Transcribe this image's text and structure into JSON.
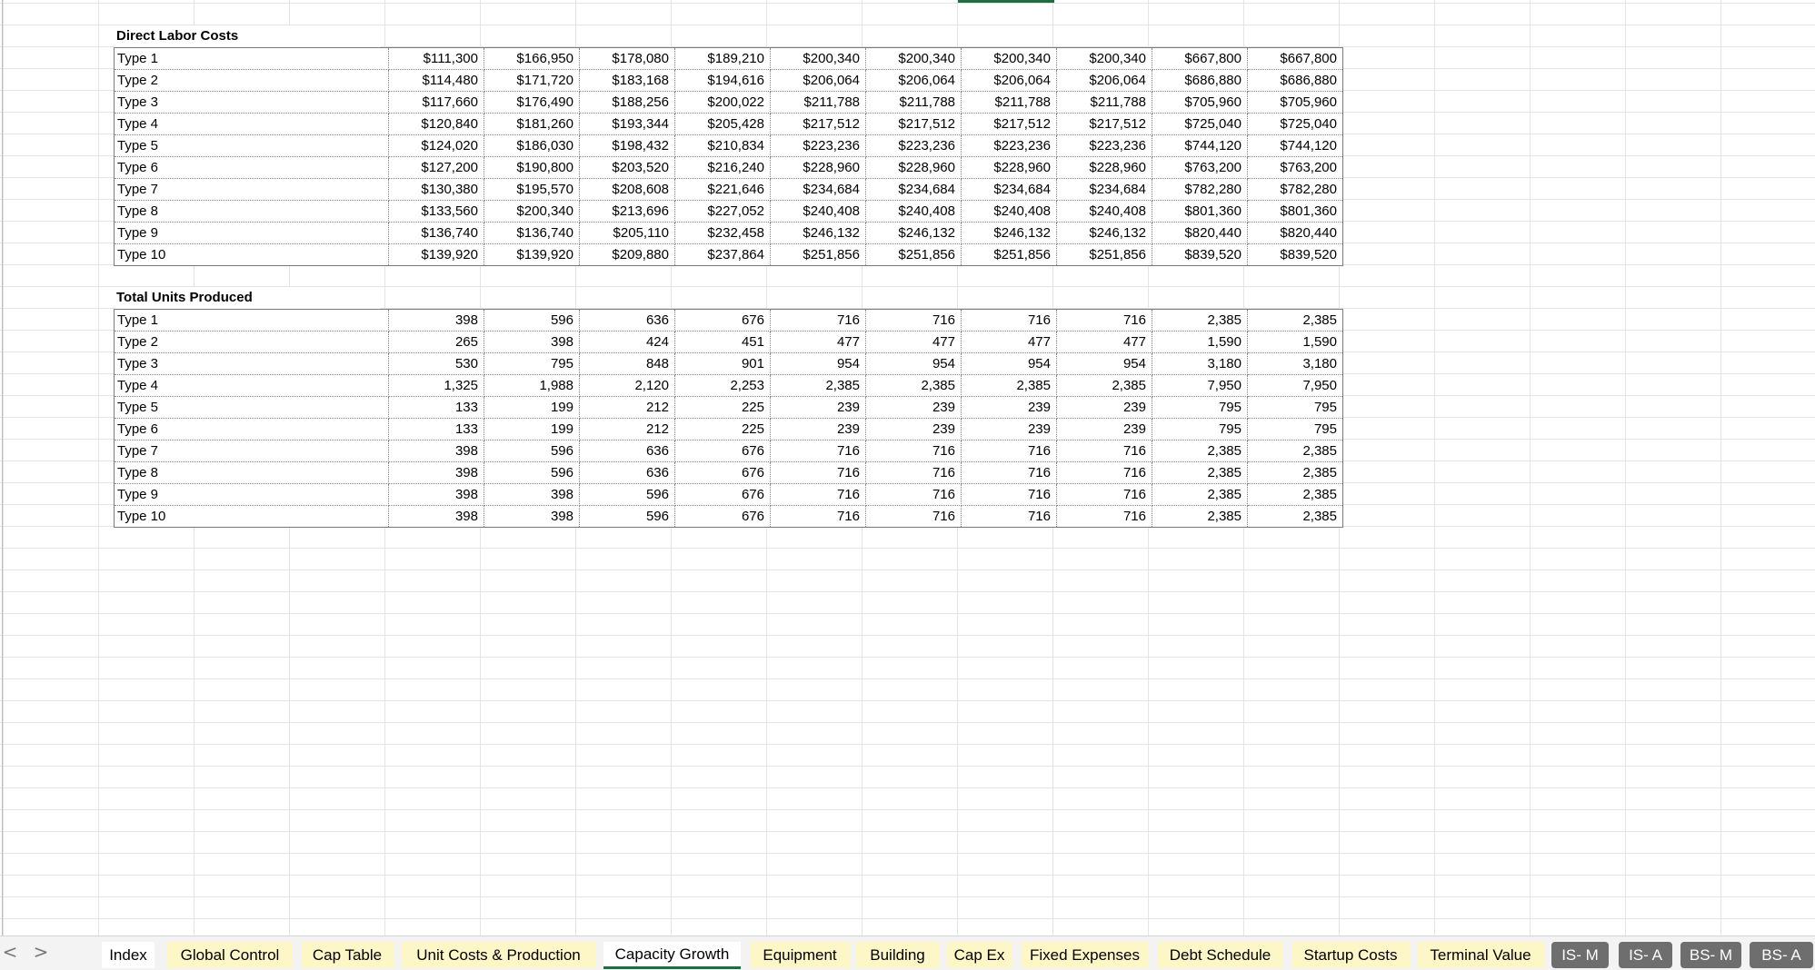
{
  "sections": {
    "labor": {
      "title": "Direct Labor Costs",
      "rows": [
        {
          "label": "Type 1",
          "values": [
            "$111,300",
            "$166,950",
            "$178,080",
            "$189,210",
            "$200,340",
            "$200,340",
            "$200,340",
            "$200,340",
            "$667,800",
            "$667,800"
          ]
        },
        {
          "label": "Type 2",
          "values": [
            "$114,480",
            "$171,720",
            "$183,168",
            "$194,616",
            "$206,064",
            "$206,064",
            "$206,064",
            "$206,064",
            "$686,880",
            "$686,880"
          ]
        },
        {
          "label": "Type 3",
          "values": [
            "$117,660",
            "$176,490",
            "$188,256",
            "$200,022",
            "$211,788",
            "$211,788",
            "$211,788",
            "$211,788",
            "$705,960",
            "$705,960"
          ]
        },
        {
          "label": "Type 4",
          "values": [
            "$120,840",
            "$181,260",
            "$193,344",
            "$205,428",
            "$217,512",
            "$217,512",
            "$217,512",
            "$217,512",
            "$725,040",
            "$725,040"
          ]
        },
        {
          "label": "Type 5",
          "values": [
            "$124,020",
            "$186,030",
            "$198,432",
            "$210,834",
            "$223,236",
            "$223,236",
            "$223,236",
            "$223,236",
            "$744,120",
            "$744,120"
          ]
        },
        {
          "label": "Type 6",
          "values": [
            "$127,200",
            "$190,800",
            "$203,520",
            "$216,240",
            "$228,960",
            "$228,960",
            "$228,960",
            "$228,960",
            "$763,200",
            "$763,200"
          ]
        },
        {
          "label": "Type 7",
          "values": [
            "$130,380",
            "$195,570",
            "$208,608",
            "$221,646",
            "$234,684",
            "$234,684",
            "$234,684",
            "$234,684",
            "$782,280",
            "$782,280"
          ]
        },
        {
          "label": "Type 8",
          "values": [
            "$133,560",
            "$200,340",
            "$213,696",
            "$227,052",
            "$240,408",
            "$240,408",
            "$240,408",
            "$240,408",
            "$801,360",
            "$801,360"
          ]
        },
        {
          "label": "Type 9",
          "values": [
            "$136,740",
            "$136,740",
            "$205,110",
            "$232,458",
            "$246,132",
            "$246,132",
            "$246,132",
            "$246,132",
            "$820,440",
            "$820,440"
          ]
        },
        {
          "label": "Type 10",
          "values": [
            "$139,920",
            "$139,920",
            "$209,880",
            "$237,864",
            "$251,856",
            "$251,856",
            "$251,856",
            "$251,856",
            "$839,520",
            "$839,520"
          ]
        }
      ]
    },
    "units": {
      "title": "Total Units Produced",
      "rows": [
        {
          "label": "Type 1",
          "values": [
            "398",
            "596",
            "636",
            "676",
            "716",
            "716",
            "716",
            "716",
            "2,385",
            "2,385"
          ]
        },
        {
          "label": "Type 2",
          "values": [
            "265",
            "398",
            "424",
            "451",
            "477",
            "477",
            "477",
            "477",
            "1,590",
            "1,590"
          ]
        },
        {
          "label": "Type 3",
          "values": [
            "530",
            "795",
            "848",
            "901",
            "954",
            "954",
            "954",
            "954",
            "3,180",
            "3,180"
          ]
        },
        {
          "label": "Type 4",
          "values": [
            "1,325",
            "1,988",
            "2,120",
            "2,253",
            "2,385",
            "2,385",
            "2,385",
            "2,385",
            "7,950",
            "7,950"
          ]
        },
        {
          "label": "Type 5",
          "values": [
            "133",
            "199",
            "212",
            "225",
            "239",
            "239",
            "239",
            "239",
            "795",
            "795"
          ]
        },
        {
          "label": "Type 6",
          "values": [
            "133",
            "199",
            "212",
            "225",
            "239",
            "239",
            "239",
            "239",
            "795",
            "795"
          ]
        },
        {
          "label": "Type 7",
          "values": [
            "398",
            "596",
            "636",
            "676",
            "716",
            "716",
            "716",
            "716",
            "2,385",
            "2,385"
          ]
        },
        {
          "label": "Type 8",
          "values": [
            "398",
            "596",
            "636",
            "676",
            "716",
            "716",
            "716",
            "716",
            "2,385",
            "2,385"
          ]
        },
        {
          "label": "Type 9",
          "values": [
            "398",
            "398",
            "596",
            "676",
            "716",
            "716",
            "716",
            "716",
            "2,385",
            "2,385"
          ]
        },
        {
          "label": "Type 10",
          "values": [
            "398",
            "398",
            "596",
            "676",
            "716",
            "716",
            "716",
            "716",
            "2,385",
            "2,385"
          ]
        }
      ]
    }
  },
  "tabbar": {
    "prev_label": "<",
    "next_label": ">",
    "tabs": [
      {
        "label": "Index",
        "style": "white"
      },
      {
        "label": "Global Control",
        "style": "yellow"
      },
      {
        "label": "Cap Table",
        "style": "yellow"
      },
      {
        "label": "Unit Costs & Production",
        "style": "yellow"
      },
      {
        "label": "Capacity Growth",
        "style": "active"
      },
      {
        "label": "Equipment",
        "style": "yellow"
      },
      {
        "label": "Building",
        "style": "yellow"
      },
      {
        "label": "Cap Ex",
        "style": "yellow"
      },
      {
        "label": "Fixed Expenses",
        "style": "yellow"
      },
      {
        "label": "Debt Schedule",
        "style": "yellow"
      },
      {
        "label": "Startup Costs",
        "style": "yellow"
      },
      {
        "label": "Terminal Value",
        "style": "yellow"
      },
      {
        "label": "IS- M",
        "style": "gray"
      },
      {
        "label": "IS- A",
        "style": "gray"
      },
      {
        "label": "BS- M",
        "style": "gray"
      },
      {
        "label": "BS- A",
        "style": "gray"
      }
    ],
    "colors": {
      "active_underline": "#1e6e3f",
      "yellow_tab": "#fdf6c6",
      "gray_tab": "#6e6e6e"
    }
  }
}
